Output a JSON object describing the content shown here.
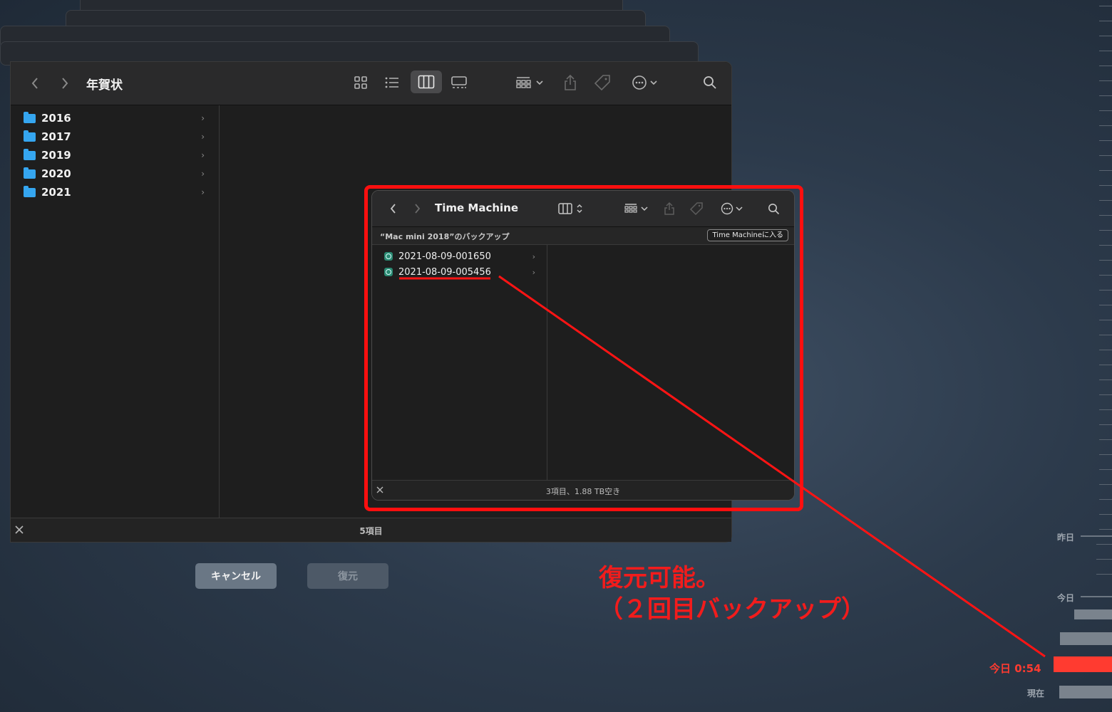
{
  "main_finder": {
    "title": "年賀状",
    "folders": [
      {
        "label": "2016"
      },
      {
        "label": "2017"
      },
      {
        "label": "2019"
      },
      {
        "label": "2020"
      },
      {
        "label": "2021"
      }
    ],
    "status": "5項目"
  },
  "time_machine": {
    "title": "Time Machine",
    "path": "“Mac mini 2018”のバックアップ",
    "enter_button": "Time Machineに入る",
    "backups": [
      {
        "label": "2021-08-09-001650"
      },
      {
        "label": "2021-08-09-005456"
      }
    ],
    "status": "3項目、1.88 TB空き"
  },
  "buttons": {
    "cancel": "キャンセル",
    "restore": "復元"
  },
  "annotation": {
    "line1": "復元可能。",
    "line2": "（２回目バックアップ）",
    "color": "#f21c1c"
  },
  "timeline": {
    "yesterday": "昨日",
    "today": "今日",
    "active": "今日 0:54",
    "now": "現在"
  },
  "colors": {
    "folder": "#35a6f0",
    "highlight": "#ff0f0f",
    "timeline_active": "#ff3b30"
  }
}
